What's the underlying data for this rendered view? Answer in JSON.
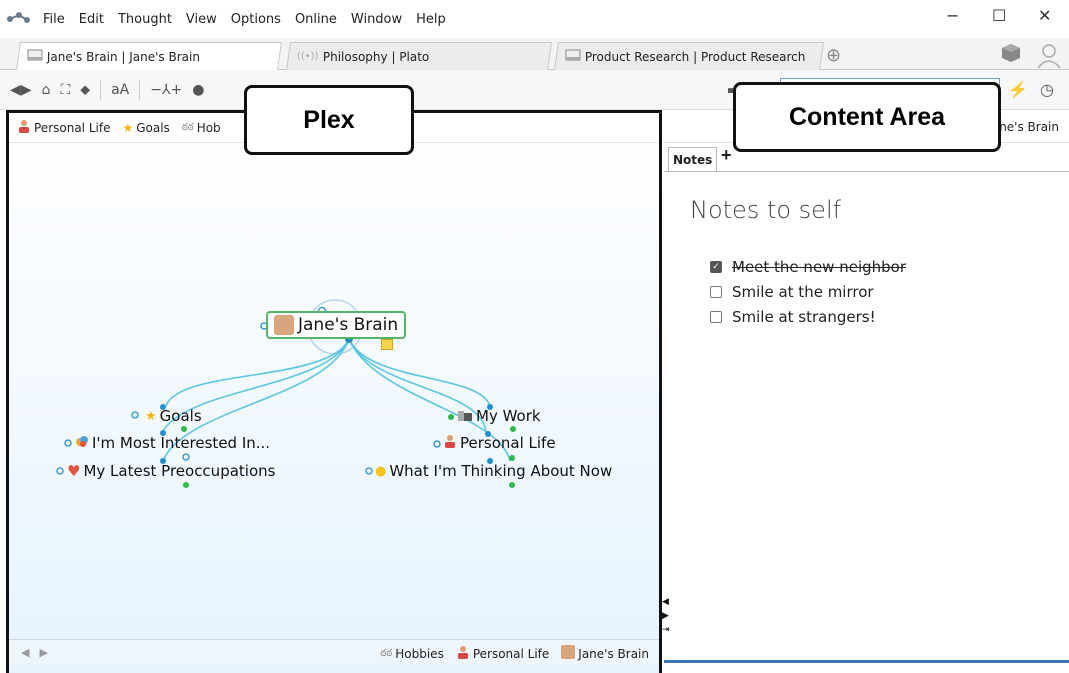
{
  "menu": {
    "items": [
      "File",
      "Edit",
      "Thought",
      "View",
      "Options",
      "Online",
      "Window",
      "Help"
    ]
  },
  "window_controls": {
    "minimize": "−",
    "maximize": "☐",
    "close": "✕"
  },
  "tabs": [
    {
      "label": "Jane's Brain | Jane's Brain",
      "active": true,
      "icon": "brain-icon"
    },
    {
      "label": "Philosophy | Plato",
      "active": false,
      "icon": "online-brain-icon"
    },
    {
      "label": "Product Research | Product Research",
      "active": false,
      "icon": "brain-icon"
    }
  ],
  "plex": {
    "pins": [
      {
        "label": "Personal Life",
        "icon": "person-icon"
      },
      {
        "label": "Goals",
        "icon": "star-icon"
      },
      {
        "label": "Hob",
        "icon": "bike-icon"
      }
    ],
    "central": {
      "label": "Jane's Brain"
    },
    "children": [
      {
        "label": "Goals",
        "icon": "star-icon"
      },
      {
        "label": "I'm Most Interested In...",
        "icon": "palette-icon"
      },
      {
        "label": "My Latest Preoccupations",
        "icon": "heart-icon"
      },
      {
        "label": "My Work",
        "icon": "building-icon"
      },
      {
        "label": "Personal Life",
        "icon": "person-icon"
      },
      {
        "label": "What I'm Thinking About Now",
        "icon": "lightbulb-icon"
      }
    ],
    "footer_pins": [
      {
        "label": "Hobbies",
        "icon": "bike-icon"
      },
      {
        "label": "Personal Life",
        "icon": "person-icon"
      },
      {
        "label": "Jane's Brain",
        "icon": "avatar-icon"
      }
    ]
  },
  "content": {
    "crumb": "ne's Brain",
    "tab_label": "Notes",
    "add_tab": "+",
    "title": "Notes to self",
    "checklist": [
      {
        "text": "Meet the new neighbor",
        "checked": true
      },
      {
        "text": "Smile at the mirror",
        "checked": false
      },
      {
        "text": "Smile at strangers!",
        "checked": false
      }
    ]
  },
  "callouts": {
    "plex": "Plex",
    "content_area": "Content Area"
  },
  "colors": {
    "link_line": "#5bc6e8",
    "central_border": "#56b36a",
    "selection": "#3d74b8"
  }
}
